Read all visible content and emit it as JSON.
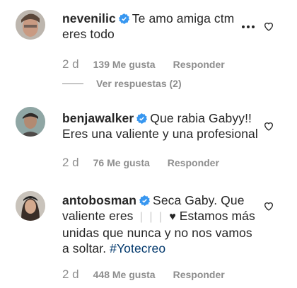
{
  "colors": {
    "verified": "#3897f0",
    "meta": "#8e8e8e",
    "text": "#262626",
    "hashtag": "#00376b"
  },
  "comments": [
    {
      "username": "nevenilic",
      "text_lines": [
        "Te amo amiga ctm",
        "eres todo"
      ],
      "time": "2 d",
      "likes": "139 Me gusta",
      "reply": "Responder",
      "view_replies": "Ver respuestas (2)"
    },
    {
      "username": "benjawalker",
      "text_lines": [
        "Que rabia Gabyy!!",
        "Eres una valiente y una profesional"
      ],
      "time": "2 d",
      "likes": "76 Me gusta",
      "reply": "Responder"
    },
    {
      "username": "antobosman",
      "text_parts": {
        "line1": "Seca Gaby. Que",
        "line2_start": "valiente eres",
        "line2_bars": "❘❘❘",
        "line2_heart": "♥",
        "line2_end": "Estamos más",
        "line3": "unidas que nunca y no nos vamos",
        "line4_start": "a soltar.",
        "hashtag": "#Yotecreo"
      },
      "time": "2 d",
      "likes": "448 Me gusta",
      "reply": "Responder"
    }
  ],
  "icons": {
    "verified": "verified-badge-icon",
    "like": "heart-outline-icon",
    "more": "more-options-icon"
  }
}
